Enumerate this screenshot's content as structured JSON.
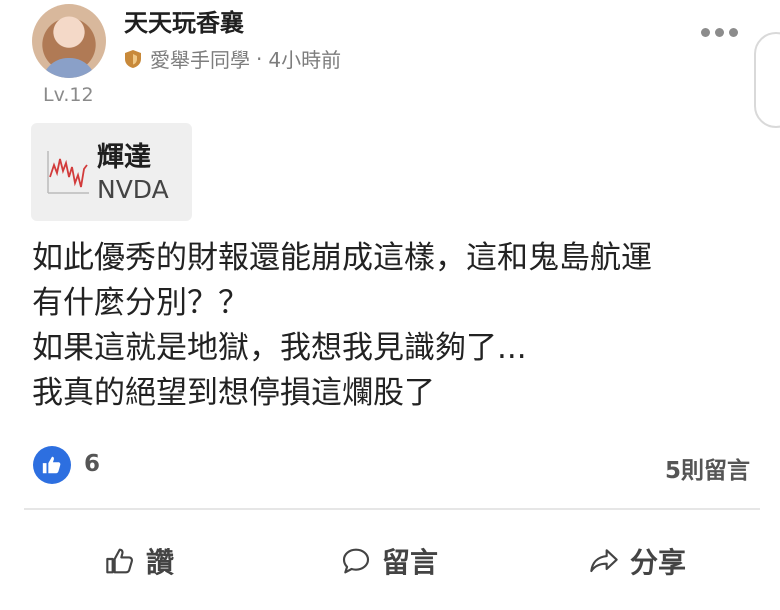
{
  "author": {
    "name": "天天玩香襄",
    "level": "Lv.12",
    "group": "愛舉手同學",
    "time": "4小時前",
    "separator": "·"
  },
  "stock": {
    "name": "輝達",
    "ticker": "NVDA"
  },
  "post": {
    "lines": [
      "如此優秀的財報還能崩成這樣，這和鬼島航運",
      "有什麼分別？？",
      "如果這就是地獄，我想我見識夠了...",
      "我真的絕望到想停損這爛股了"
    ]
  },
  "stats": {
    "likes": "6",
    "comments": "5則留言"
  },
  "actions": {
    "like_label": "讚",
    "comment_label": "留言",
    "share_label": "分享"
  },
  "colors": {
    "like_blue": "#2d6fe0",
    "badge_orange": "#c8893a",
    "chart_red": "#d23b3b"
  },
  "icons": {
    "more": "more-horizontal-icon",
    "like": "thumbs-up-icon",
    "comment": "speech-bubble-icon",
    "share": "share-arrow-icon"
  }
}
